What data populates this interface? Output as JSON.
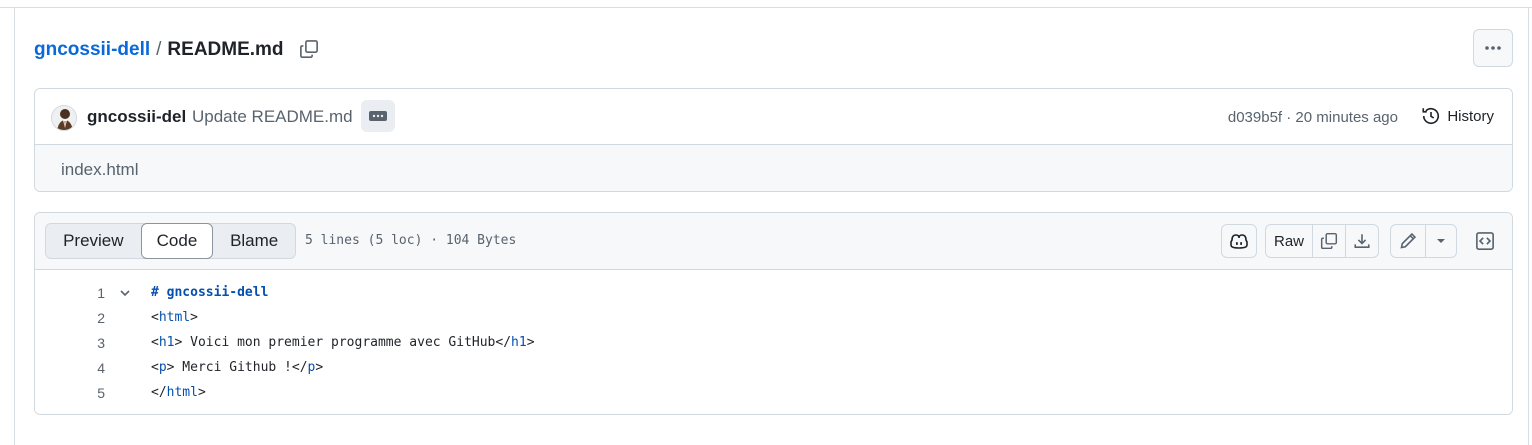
{
  "breadcrumb": {
    "repo": "gncossii-dell",
    "separator": "/",
    "file": "README.md"
  },
  "commit": {
    "author": "gncossii-del",
    "message": "Update README.md",
    "sha_time": "d039b5f · 20 minutes ago",
    "history_label": "History",
    "description": "index.html"
  },
  "file_header": {
    "tabs": [
      "Preview",
      "Code",
      "Blame"
    ],
    "active_tab": "Code",
    "info": "5 lines (5 loc) · 104 Bytes",
    "raw_label": "Raw"
  },
  "code_lines": [
    {
      "num": "1",
      "parts": [
        {
          "t": "# gncossii-dell",
          "c": "hd"
        }
      ]
    },
    {
      "num": "2",
      "parts": [
        {
          "t": "<",
          "c": ""
        },
        {
          "t": "html",
          "c": "tg"
        },
        {
          "t": ">",
          "c": ""
        }
      ]
    },
    {
      "num": "3",
      "parts": [
        {
          "t": "<",
          "c": ""
        },
        {
          "t": "h1",
          "c": "tg"
        },
        {
          "t": "> Voici mon premier programme avec GitHub</",
          "c": ""
        },
        {
          "t": "h1",
          "c": "tg"
        },
        {
          "t": ">",
          "c": ""
        }
      ]
    },
    {
      "num": "4",
      "parts": [
        {
          "t": "<",
          "c": ""
        },
        {
          "t": "p",
          "c": "tg"
        },
        {
          "t": "> Merci Github !</",
          "c": ""
        },
        {
          "t": "p",
          "c": "tg"
        },
        {
          "t": ">",
          "c": ""
        }
      ]
    },
    {
      "num": "5",
      "parts": [
        {
          "t": "</",
          "c": ""
        },
        {
          "t": "html",
          "c": "tg"
        },
        {
          "t": ">",
          "c": ""
        }
      ]
    }
  ],
  "icons": {
    "copy_path": "copy-icon",
    "more": "kebab-horizontal-icon",
    "history": "history-icon",
    "copilot": "copilot-icon",
    "copy_raw": "copy-icon",
    "download": "download-icon",
    "edit": "pencil-icon",
    "caret": "triangle-down-icon",
    "symbols": "code-square-icon",
    "fold": "chevron-down-icon"
  },
  "colors": {
    "link": "#0969da",
    "tag": "#0550ae",
    "muted": "#59636e",
    "border": "#d1d9e0",
    "subtle_bg": "#f6f8fa"
  }
}
